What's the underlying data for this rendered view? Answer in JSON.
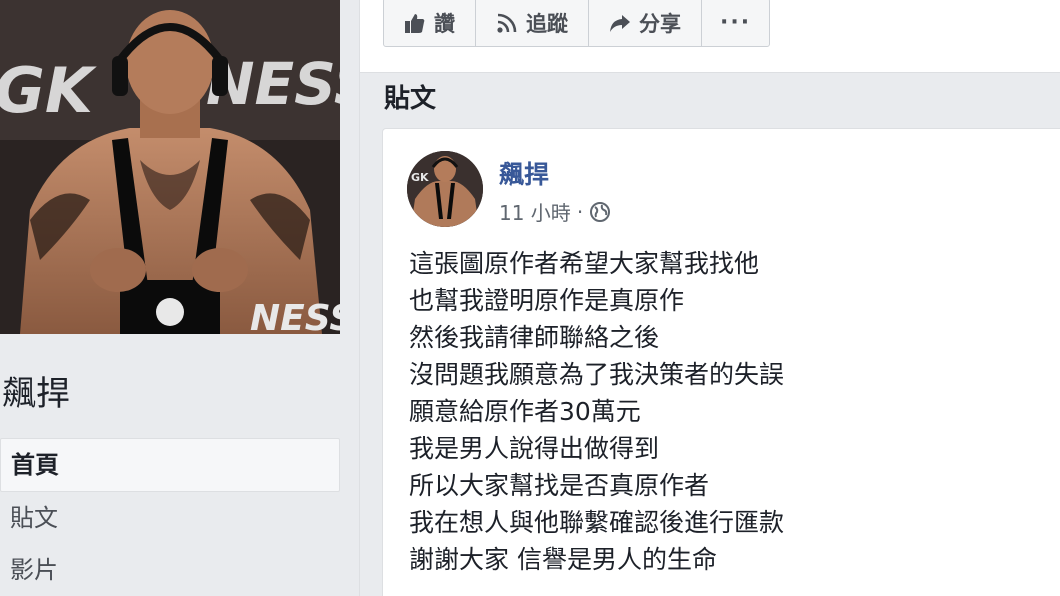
{
  "page": {
    "name": "飆捍"
  },
  "nav": {
    "items": [
      {
        "label": "首頁"
      },
      {
        "label": "貼文"
      },
      {
        "label": "影片"
      }
    ]
  },
  "actions": {
    "like_label": "讚",
    "follow_label": "追蹤",
    "share_label": "分享",
    "more_label": "···"
  },
  "section": {
    "title": "貼文"
  },
  "post": {
    "author": "飆捍",
    "time": "11 小時",
    "separator": "·",
    "privacy_icon": "globe-icon",
    "lines": [
      "這張圖原作者希望大家幫我找他",
      "也幫我證明原作是真原作",
      "然後我請律師聯絡之後",
      "沒問題我願意為了我決策者的失誤",
      "願意給原作者30萬元",
      "我是男人說得出做得到",
      "所以大家幫找是否真原作者",
      "我在想人與他聯繫確認後進行匯款",
      "謝謝大家 信譽是男人的生命"
    ]
  },
  "colors": {
    "link_blue": "#385898",
    "background": "#e9ebee",
    "card": "#ffffff",
    "border": "#dddfe2"
  }
}
